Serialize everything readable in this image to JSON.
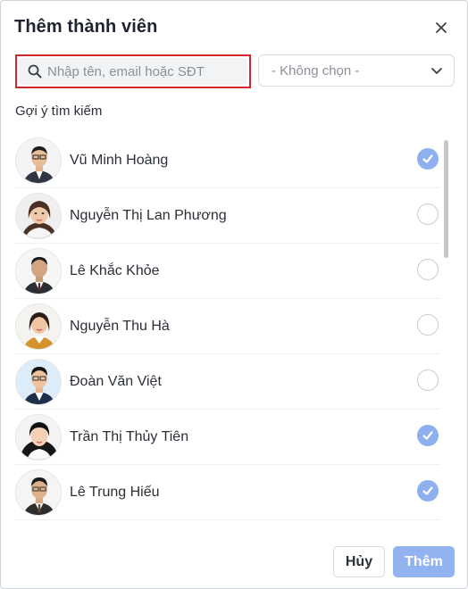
{
  "dialog": {
    "title": "Thêm thành viên",
    "close_icon": "close-icon"
  },
  "search": {
    "placeholder": "Nhập tên, email hoặc SĐT",
    "value": "",
    "icon": "search-icon"
  },
  "filter": {
    "selected": "- Không chọn -",
    "icon": "chevron-down-icon"
  },
  "suggestions": {
    "label": "Gợi ý tìm kiếm",
    "items": [
      {
        "name": "Vũ Minh Hoàng",
        "checked": true
      },
      {
        "name": "Nguyễn Thị Lan Phương",
        "checked": false
      },
      {
        "name": "Lê Khắc Khỏe",
        "checked": false
      },
      {
        "name": "Nguyễn Thu Hà",
        "checked": false
      },
      {
        "name": "Đoàn Văn Việt",
        "checked": false
      },
      {
        "name": "Trần Thị Thủy Tiên",
        "checked": true
      },
      {
        "name": "Lê Trung Hiếu",
        "checked": true
      }
    ]
  },
  "footer": {
    "cancel_label": "Hủy",
    "add_label": "Thêm"
  },
  "colors": {
    "accent": "#8fb0ef",
    "highlight_border": "#d0262e"
  }
}
